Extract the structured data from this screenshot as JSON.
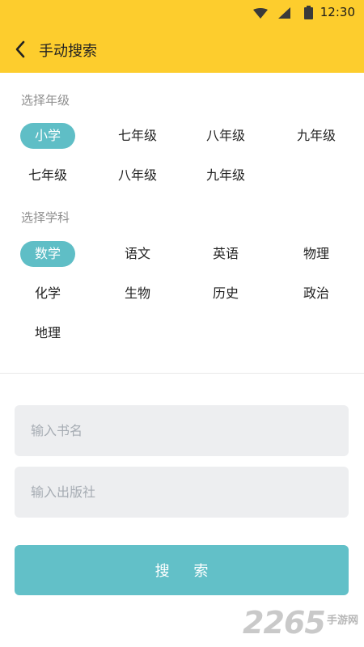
{
  "status_bar": {
    "time": "12:30",
    "icons": [
      "wifi-icon",
      "signal-icon",
      "battery-icon"
    ]
  },
  "header": {
    "back_icon": "chevron-left-icon",
    "title": "手动搜索"
  },
  "grade_section": {
    "label": "选择年级",
    "options": [
      "小学",
      "七年级",
      "八年级",
      "九年级",
      "七年级",
      "八年级",
      "九年级"
    ],
    "selected": "小学"
  },
  "subject_section": {
    "label": "选择学科",
    "options": [
      "数学",
      "语文",
      "英语",
      "物理",
      "化学",
      "生物",
      "历史",
      "政治",
      "地理"
    ],
    "selected": "数学"
  },
  "form": {
    "book_name": {
      "placeholder": "输入书名",
      "value": ""
    },
    "publisher": {
      "placeholder": "输入出版社",
      "value": ""
    },
    "search_label": "搜 索"
  },
  "watermark": {
    "number": "2265",
    "text": "手游网"
  },
  "colors": {
    "header_bg": "#FDCD2D",
    "accent": "#5FBEC6",
    "field_bg": "#EDEEF0"
  }
}
